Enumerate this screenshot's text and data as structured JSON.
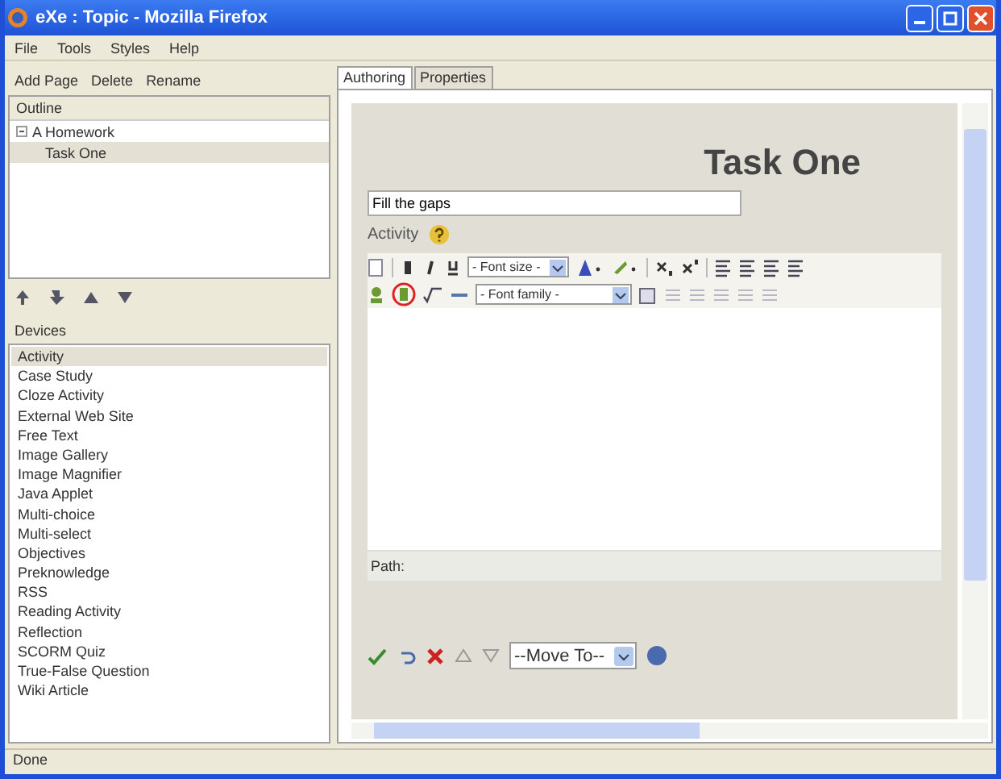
{
  "window": {
    "title": "eXe : Topic - Mozilla Firefox"
  },
  "menu": [
    "File",
    "Tools",
    "Styles",
    "Help"
  ],
  "outline_toolbar": [
    "Add Page",
    "Delete",
    "Rename"
  ],
  "outline": {
    "header": "Outline",
    "tree": [
      {
        "label": "A Homework",
        "expanded": true,
        "selected": false,
        "children": [
          {
            "label": "Task One",
            "selected": true
          }
        ]
      }
    ]
  },
  "devices": {
    "header": "Devices",
    "items": [
      {
        "label": "Activity",
        "selected": true
      },
      {
        "label": "Case Study",
        "selected": false
      },
      {
        "label": "Cloze Activity",
        "selected": false
      },
      {
        "label": "External Web Site",
        "selected": false
      },
      {
        "label": "Free Text",
        "selected": false
      },
      {
        "label": "Image Gallery",
        "selected": false
      },
      {
        "label": "Image Magnifier",
        "selected": false
      },
      {
        "label": "Java Applet",
        "selected": false
      },
      {
        "label": "Multi-choice",
        "selected": false
      },
      {
        "label": "Multi-select",
        "selected": false
      },
      {
        "label": "Objectives",
        "selected": false
      },
      {
        "label": "Preknowledge",
        "selected": false
      },
      {
        "label": "RSS",
        "selected": false
      },
      {
        "label": "Reading Activity",
        "selected": false
      },
      {
        "label": "Reflection",
        "selected": false
      },
      {
        "label": "SCORM Quiz",
        "selected": false
      },
      {
        "label": "True-False Question",
        "selected": false
      },
      {
        "label": "Wiki Article",
        "selected": false
      }
    ]
  },
  "tabs": [
    {
      "label": "Authoring",
      "selected": true
    },
    {
      "label": "Properties",
      "selected": false
    }
  ],
  "page": {
    "title": "Task One",
    "idevice_title": "Fill the gaps",
    "idevice_label": "Activity",
    "editor": {
      "font_size": "- Font size -",
      "font_family": "- Font family -",
      "path_label": "Path:"
    },
    "move_to": "--Move To--"
  },
  "status_bar": "Done"
}
